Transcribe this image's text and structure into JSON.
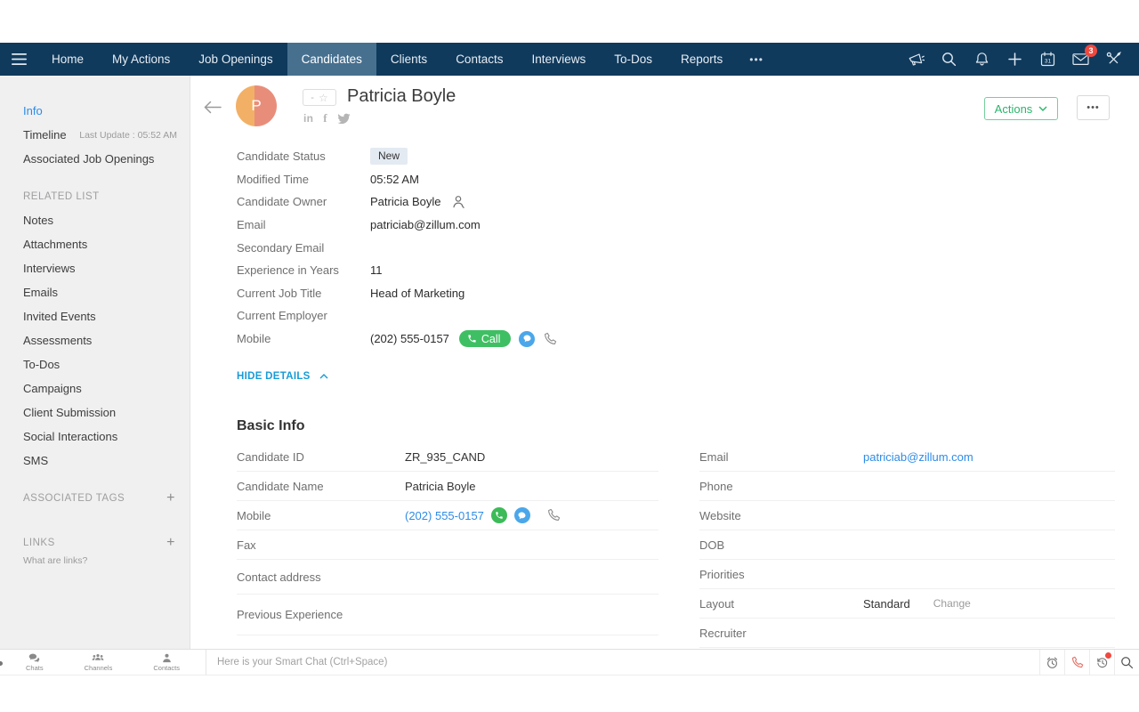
{
  "colors": {
    "nav_bg": "#103a5c",
    "nav_active_bg": "#47708f",
    "link_blue": "#2e8ce6",
    "hide_details_blue": "#189bd7",
    "call_green": "#3fbf63",
    "actions_green": "#2bb46c",
    "badge_red": "#f0483e",
    "status_badge_bg": "#e4eaf2",
    "sidebar_bg": "#f0f0f1"
  },
  "nav": {
    "tabs": [
      "Home",
      "My Actions",
      "Job Openings",
      "Candidates",
      "Clients",
      "Contacts",
      "Interviews",
      "To-Dos",
      "Reports"
    ],
    "active_tab": "Candidates",
    "more_label": "•••",
    "mail_badge": "3",
    "icon_names": [
      "hamburger-menu-icon",
      "announcement-icon",
      "search-icon",
      "notifications-icon",
      "add-icon",
      "calendar-icon",
      "mail-icon",
      "setup-icon"
    ]
  },
  "sidebar": {
    "info": "Info",
    "timeline": "Timeline",
    "timeline_meta": "Last Update : 05:52 AM",
    "associated_job_openings": "Associated Job Openings",
    "related_list_header": "RELATED LIST",
    "related_items": [
      "Notes",
      "Attachments",
      "Interviews",
      "Emails",
      "Invited Events",
      "Assessments",
      "To-Dos",
      "Campaigns",
      "Client Submission",
      "Social Interactions",
      "SMS"
    ],
    "associated_tags_header": "ASSOCIATED TAGS",
    "links_header": "LINKS",
    "links_help": "What are links?",
    "add_label": "+"
  },
  "header": {
    "title": "Patricia Boyle",
    "avatar_initial": "P",
    "rating_value": "-",
    "rating_star": "☆",
    "linkedin_label": "in",
    "facebook_label": "f",
    "social_icon_names": [
      "linkedin-icon",
      "facebook-icon",
      "twitter-icon"
    ],
    "actions_label": "Actions",
    "more_label": "•••"
  },
  "details": {
    "rows": [
      {
        "label": "Candidate Status",
        "value": "New"
      },
      {
        "label": "Modified Time",
        "value": "05:52 AM"
      },
      {
        "label": "Candidate Owner",
        "value": "Patricia Boyle"
      },
      {
        "label": "Email",
        "value": "patriciab@zillum.com"
      },
      {
        "label": "Secondary Email",
        "value": ""
      },
      {
        "label": "Experience in Years",
        "value": "11"
      },
      {
        "label": "Current Job Title",
        "value": "Head of Marketing"
      },
      {
        "label": "Current Employer",
        "value": ""
      },
      {
        "label": "Mobile",
        "value": "(202) 555-0157"
      }
    ],
    "call_label": "Call",
    "hide_details_label": "HIDE DETAILS"
  },
  "basic_info": {
    "heading": "Basic Info",
    "left_rows": [
      {
        "label": "Candidate ID",
        "value": "ZR_935_CAND"
      },
      {
        "label": "Candidate Name",
        "value": "Patricia Boyle"
      },
      {
        "label": "Mobile",
        "value": "(202) 555-0157"
      },
      {
        "label": "Fax",
        "value": ""
      },
      {
        "label": "Contact address",
        "value": ""
      },
      {
        "label": "Previous Experience",
        "value": ""
      }
    ],
    "right_rows": [
      {
        "label": "Email",
        "value": "patriciab@zillum.com"
      },
      {
        "label": "Phone",
        "value": ""
      },
      {
        "label": "Website",
        "value": ""
      },
      {
        "label": "DOB",
        "value": ""
      },
      {
        "label": "Priorities",
        "value": ""
      },
      {
        "label": "Layout",
        "value": "Standard",
        "action": "Change"
      },
      {
        "label": "Recruiter",
        "value": ""
      }
    ]
  },
  "chat_bar": {
    "items": [
      "Chats",
      "Channels",
      "Contacts"
    ],
    "placeholder": "Here is your Smart Chat (Ctrl+Space)",
    "right_icon_names": [
      "alarm-icon",
      "call-icon",
      "history-icon",
      "search-icon"
    ]
  }
}
